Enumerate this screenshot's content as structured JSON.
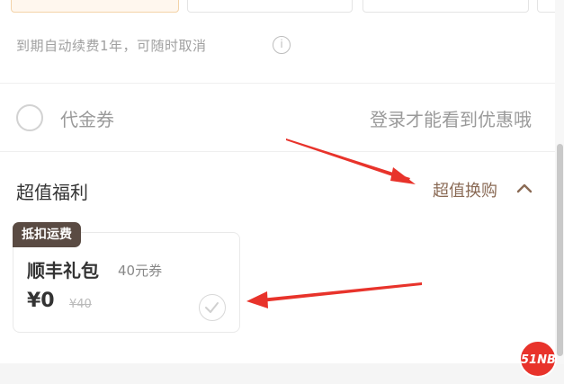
{
  "renew_notice": "到期自动续费1年，可随时取消",
  "info_icon": "info-icon",
  "voucher": {
    "label": "代金券",
    "login_hint": "登录才能看到优惠哦"
  },
  "benefits": {
    "title": "超值福利",
    "deal_link": "超值换购",
    "expand_icon": "chevron-up-icon"
  },
  "offer_card": {
    "badge": "抵扣运费",
    "title": "顺丰礼包",
    "subtitle": "40元券",
    "price": "¥0",
    "original_price": "¥40"
  },
  "watermark": "51NB",
  "colors": {
    "annotation_arrow": "#e8332b",
    "badge_bg": "#5a4b43",
    "deal_link": "#8a6a55"
  }
}
